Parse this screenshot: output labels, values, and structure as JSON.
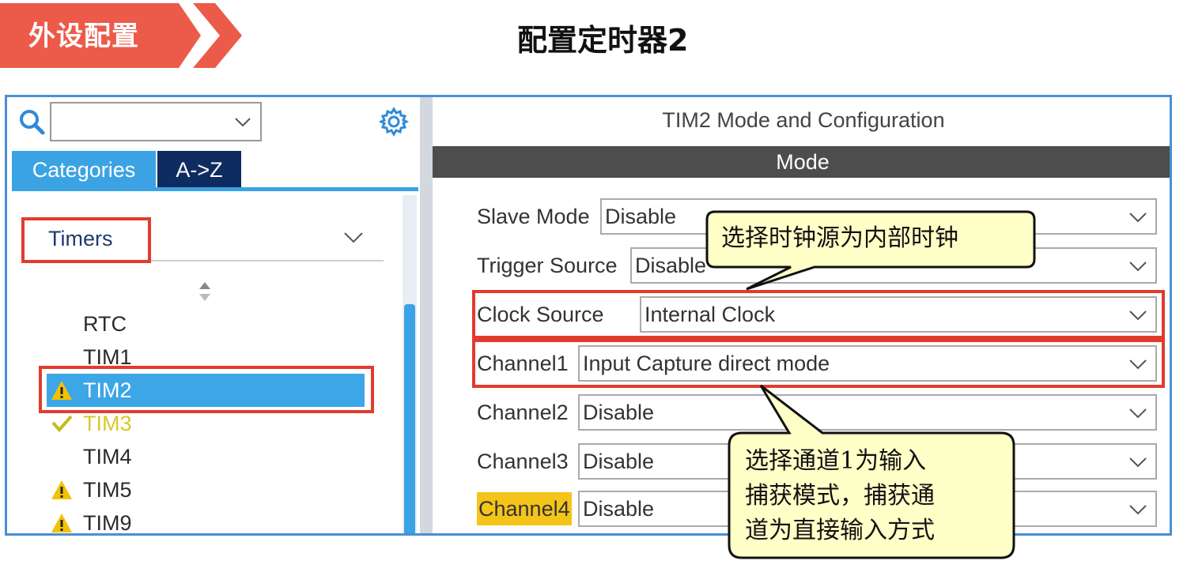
{
  "header": {
    "section_label": "外设配置",
    "page_title": "配置定时器2"
  },
  "colors": {
    "banner": "#ec5b4a",
    "accent_blue": "#3ba3e3",
    "dark_tab": "#0f2c61",
    "mode_bar": "#4d4d4d",
    "highlight_red": "#e23b2e",
    "warning_yellow": "#f5c418",
    "callout_fill": "#ffffc8"
  },
  "left_panel": {
    "search": {
      "value": "",
      "icon": "search-icon"
    },
    "settings_icon": "gear-icon",
    "tabs": [
      {
        "label": "Categories",
        "active": true
      },
      {
        "label": "A->Z",
        "active": false
      }
    ],
    "category": "Timers",
    "items": [
      {
        "label": "RTC",
        "status": "none"
      },
      {
        "label": "TIM1",
        "status": "none"
      },
      {
        "label": "TIM2",
        "status": "warning",
        "selected": true
      },
      {
        "label": "TIM3",
        "status": "ok"
      },
      {
        "label": "TIM4",
        "status": "none"
      },
      {
        "label": "TIM5",
        "status": "warning"
      },
      {
        "label": "TIM9",
        "status": "warning"
      }
    ]
  },
  "right_panel": {
    "title": "TIM2 Mode and Configuration",
    "section": "Mode",
    "fields": [
      {
        "label": "Slave Mode",
        "value": "Disable"
      },
      {
        "label": "Trigger Source",
        "value": "Disable"
      },
      {
        "label": "Clock Source",
        "value": "Internal Clock"
      },
      {
        "label": "Channel1",
        "value": "Input Capture direct mode"
      },
      {
        "label": "Channel2",
        "value": "Disable"
      },
      {
        "label": "Channel3",
        "value": "Disable"
      },
      {
        "label": "Channel4",
        "value": "Disable"
      }
    ]
  },
  "callouts": {
    "clock": "选择时钟源为内部时钟",
    "channel_line1": "选择通道1为输入",
    "channel_line2": "捕获模式，捕获通",
    "channel_line3": "道为直接输入方式"
  }
}
